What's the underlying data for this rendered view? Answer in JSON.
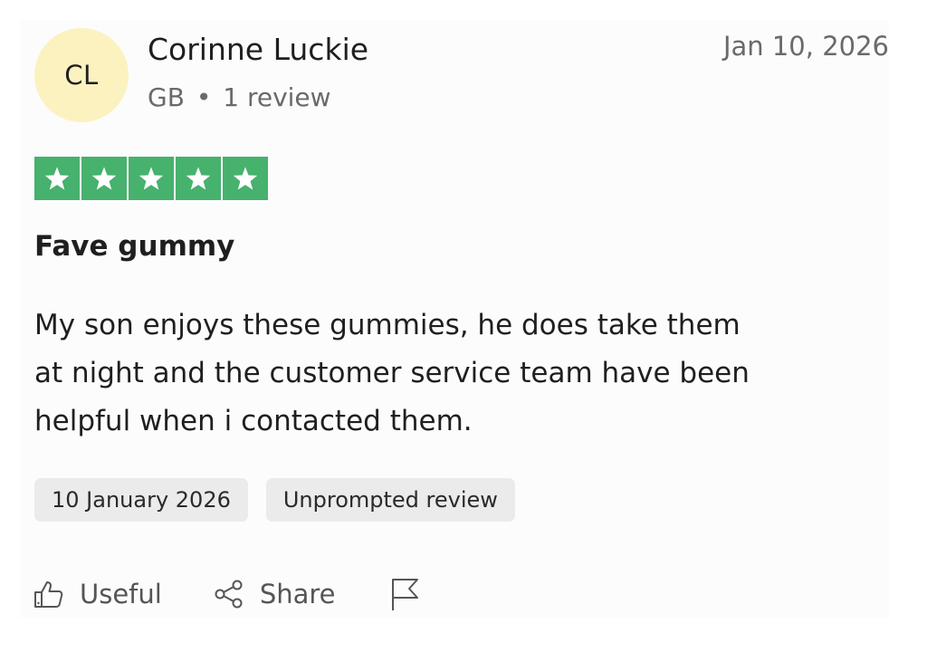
{
  "review": {
    "author": {
      "initials": "CL",
      "name": "Corinne Luckie",
      "country": "GB",
      "separator": "•",
      "review_count": "1 review"
    },
    "date_short": "Jan 10, 2026",
    "rating": {
      "value": 5,
      "max": 5,
      "color": "#47b16e"
    },
    "title": "Fave gummy",
    "body": "My son enjoys these gummies, he does take them at night and the customer service team have been helpful when i contacted them.",
    "badges": {
      "date_long": "10 January 2026",
      "type": "Unprompted review"
    },
    "actions": {
      "useful_label": "Useful",
      "useful_icon": "thumbs-up-icon",
      "share_label": "Share",
      "share_icon": "share-icon",
      "report_icon": "flag-icon"
    }
  },
  "colors": {
    "avatar_bg": "#fbf2c0",
    "muted_text": "#6a6a6a",
    "badge_bg": "#ebebeb"
  }
}
